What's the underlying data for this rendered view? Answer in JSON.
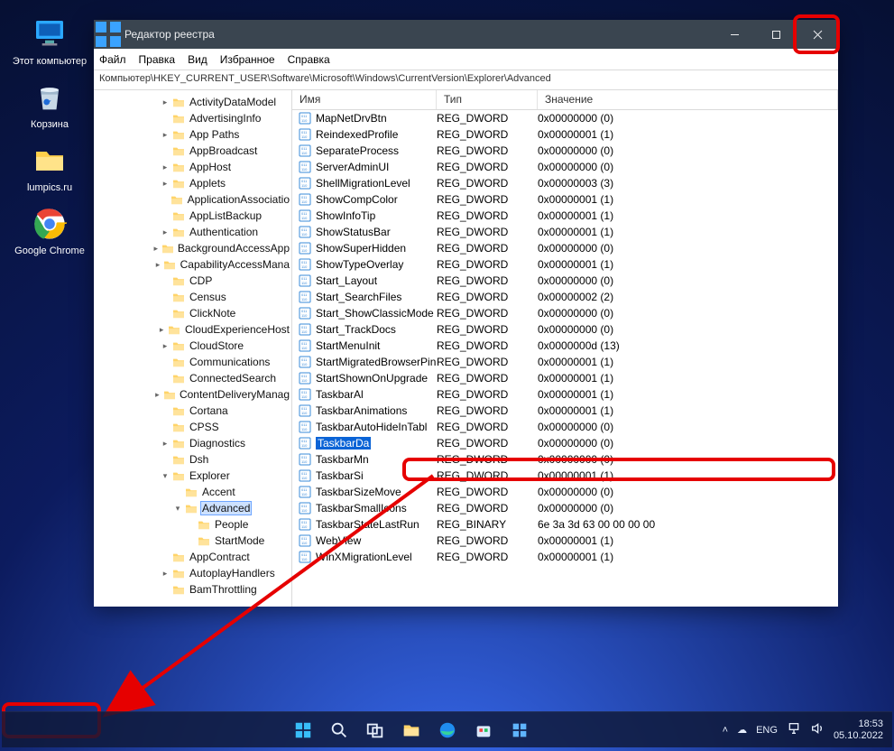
{
  "desktop": {
    "items": [
      {
        "label": "Этот компьютер",
        "icon": "pc"
      },
      {
        "label": "Корзина",
        "icon": "bin"
      },
      {
        "label": "lumpics.ru",
        "icon": "folder"
      },
      {
        "label": "Google Chrome",
        "icon": "chrome"
      }
    ]
  },
  "window": {
    "title": "Редактор реестра",
    "menu": [
      "Файл",
      "Правка",
      "Вид",
      "Избранное",
      "Справка"
    ],
    "path": "Компьютер\\HKEY_CURRENT_USER\\Software\\Microsoft\\Windows\\CurrentVersion\\Explorer\\Advanced",
    "tree": [
      {
        "d": 3,
        "tw": ">",
        "l": "ActivityDataModel"
      },
      {
        "d": 3,
        "tw": "",
        "l": "AdvertisingInfo"
      },
      {
        "d": 3,
        "tw": ">",
        "l": "App Paths"
      },
      {
        "d": 3,
        "tw": "",
        "l": "AppBroadcast"
      },
      {
        "d": 3,
        "tw": ">",
        "l": "AppHost"
      },
      {
        "d": 3,
        "tw": ">",
        "l": "Applets"
      },
      {
        "d": 3,
        "tw": "",
        "l": "ApplicationAssociatio"
      },
      {
        "d": 3,
        "tw": "",
        "l": "AppListBackup"
      },
      {
        "d": 3,
        "tw": ">",
        "l": "Authentication"
      },
      {
        "d": 3,
        "tw": ">",
        "l": "BackgroundAccessApp"
      },
      {
        "d": 3,
        "tw": ">",
        "l": "CapabilityAccessMana"
      },
      {
        "d": 3,
        "tw": "",
        "l": "CDP"
      },
      {
        "d": 3,
        "tw": "",
        "l": "Census"
      },
      {
        "d": 3,
        "tw": "",
        "l": "ClickNote"
      },
      {
        "d": 3,
        "tw": ">",
        "l": "CloudExperienceHost"
      },
      {
        "d": 3,
        "tw": ">",
        "l": "CloudStore"
      },
      {
        "d": 3,
        "tw": "",
        "l": "Communications"
      },
      {
        "d": 3,
        "tw": "",
        "l": "ConnectedSearch"
      },
      {
        "d": 3,
        "tw": ">",
        "l": "ContentDeliveryManag"
      },
      {
        "d": 3,
        "tw": "",
        "l": "Cortana"
      },
      {
        "d": 3,
        "tw": "",
        "l": "CPSS"
      },
      {
        "d": 3,
        "tw": ">",
        "l": "Diagnostics"
      },
      {
        "d": 3,
        "tw": "",
        "l": "Dsh"
      },
      {
        "d": 3,
        "tw": "v",
        "l": "Explorer"
      },
      {
        "d": 4,
        "tw": "",
        "l": "Accent"
      },
      {
        "d": 4,
        "tw": "v",
        "l": "Advanced",
        "sel": true
      },
      {
        "d": 5,
        "tw": "",
        "l": "People"
      },
      {
        "d": 5,
        "tw": "",
        "l": "StartMode"
      },
      {
        "d": 3,
        "tw": "",
        "l": "AppContract"
      },
      {
        "d": 3,
        "tw": ">",
        "l": "AutoplayHandlers"
      },
      {
        "d": 3,
        "tw": "",
        "l": "BamThrottling"
      }
    ],
    "cols": {
      "c1": "Имя",
      "c2": "Тип",
      "c3": "Значение"
    },
    "rows": [
      {
        "n": "MapNetDrvBtn",
        "t": "REG_DWORD",
        "v": "0x00000000 (0)"
      },
      {
        "n": "ReindexedProfile",
        "t": "REG_DWORD",
        "v": "0x00000001 (1)"
      },
      {
        "n": "SeparateProcess",
        "t": "REG_DWORD",
        "v": "0x00000000 (0)"
      },
      {
        "n": "ServerAdminUI",
        "t": "REG_DWORD",
        "v": "0x00000000 (0)"
      },
      {
        "n": "ShellMigrationLevel",
        "t": "REG_DWORD",
        "v": "0x00000003 (3)"
      },
      {
        "n": "ShowCompColor",
        "t": "REG_DWORD",
        "v": "0x00000001 (1)"
      },
      {
        "n": "ShowInfoTip",
        "t": "REG_DWORD",
        "v": "0x00000001 (1)"
      },
      {
        "n": "ShowStatusBar",
        "t": "REG_DWORD",
        "v": "0x00000001 (1)"
      },
      {
        "n": "ShowSuperHidden",
        "t": "REG_DWORD",
        "v": "0x00000000 (0)"
      },
      {
        "n": "ShowTypeOverlay",
        "t": "REG_DWORD",
        "v": "0x00000001 (1)"
      },
      {
        "n": "Start_Layout",
        "t": "REG_DWORD",
        "v": "0x00000000 (0)"
      },
      {
        "n": "Start_SearchFiles",
        "t": "REG_DWORD",
        "v": "0x00000002 (2)"
      },
      {
        "n": "Start_ShowClassicMode",
        "t": "REG_DWORD",
        "v": "0x00000000 (0)"
      },
      {
        "n": "Start_TrackDocs",
        "t": "REG_DWORD",
        "v": "0x00000000 (0)"
      },
      {
        "n": "StartMenuInit",
        "t": "REG_DWORD",
        "v": "0x0000000d (13)"
      },
      {
        "n": "StartMigratedBrowserPin",
        "t": "REG_DWORD",
        "v": "0x00000001 (1)"
      },
      {
        "n": "StartShownOnUpgrade",
        "t": "REG_DWORD",
        "v": "0x00000001 (1)"
      },
      {
        "n": "TaskbarAl",
        "t": "REG_DWORD",
        "v": "0x00000001 (1)"
      },
      {
        "n": "TaskbarAnimations",
        "t": "REG_DWORD",
        "v": "0x00000001 (1)"
      },
      {
        "n": "TaskbarAutoHideInTabl",
        "t": "REG_DWORD",
        "v": "0x00000000 (0)"
      },
      {
        "n": "TaskbarDa",
        "t": "REG_DWORD",
        "v": "0x00000000 (0)",
        "sel": true
      },
      {
        "n": "TaskbarMn",
        "t": "REG_DWORD",
        "v": "0x00000000 (0)"
      },
      {
        "n": "TaskbarSi",
        "t": "REG_DWORD",
        "v": "0x00000001 (1)"
      },
      {
        "n": "TaskbarSizeMove",
        "t": "REG_DWORD",
        "v": "0x00000000 (0)"
      },
      {
        "n": "TaskbarSmallIcons",
        "t": "REG_DWORD",
        "v": "0x00000000 (0)"
      },
      {
        "n": "TaskbarStateLastRun",
        "t": "REG_BINARY",
        "v": "6e 3a 3d 63 00 00 00 00"
      },
      {
        "n": "WebView",
        "t": "REG_DWORD",
        "v": "0x00000001 (1)"
      },
      {
        "n": "WinXMigrationLevel",
        "t": "REG_DWORD",
        "v": "0x00000001 (1)"
      }
    ]
  },
  "taskbar": {
    "lang": "ENG",
    "time": "18:53",
    "date": "05.10.2022"
  }
}
